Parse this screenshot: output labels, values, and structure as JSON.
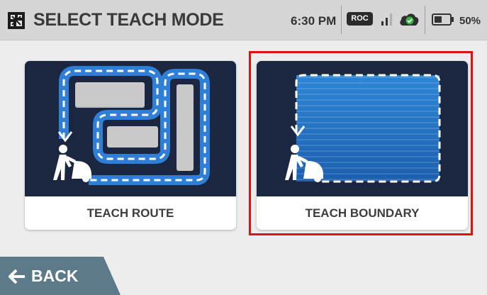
{
  "header": {
    "title": "SELECT TEACH MODE",
    "time": "6:30 PM",
    "roc_badge": "ROC",
    "battery_percent": "50%",
    "battery_level": 0.5,
    "icons": [
      "app-logo-icon",
      "signal-icon",
      "cloud-check-icon",
      "battery-icon"
    ]
  },
  "cards": [
    {
      "label": "TEACH ROUTE",
      "selected": false
    },
    {
      "label": "TEACH BOUNDARY",
      "selected": true
    }
  ],
  "back_button": {
    "label": "BACK",
    "icon": "arrow-left-icon"
  },
  "colors": {
    "selection": "#e31010",
    "card_art_background": "#1b2640",
    "path_blue": "#2f7fd8",
    "boundary_fill": "#1f6fc4",
    "back_button": "#5d7a8a",
    "cloud_check": "#3bb34a"
  }
}
